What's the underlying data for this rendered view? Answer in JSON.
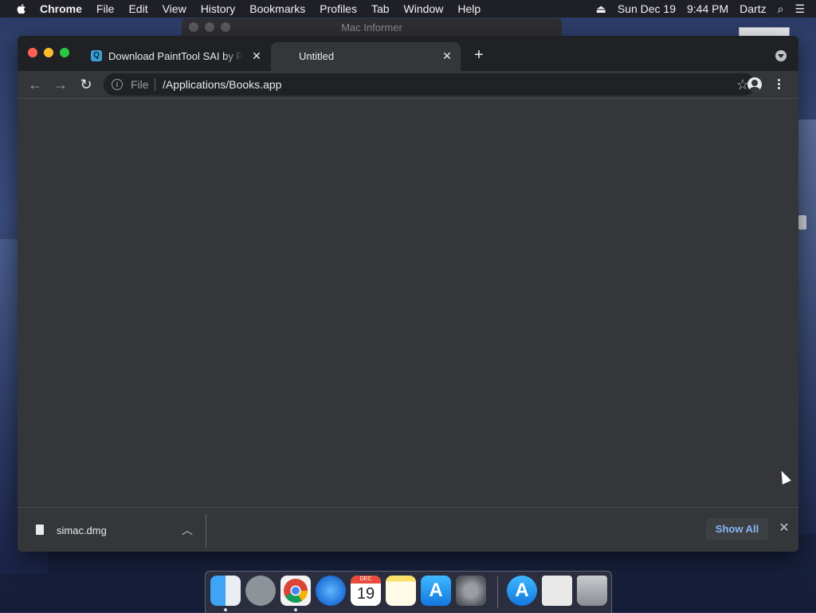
{
  "menubar": {
    "app_name": "Chrome",
    "items": [
      "File",
      "Edit",
      "View",
      "History",
      "Bookmarks",
      "Profiles",
      "Tab",
      "Window",
      "Help"
    ],
    "date": "Sun Dec 19",
    "time": "9:44 PM",
    "user": "Dartz"
  },
  "background_window": {
    "title": "Mac Informer"
  },
  "browser": {
    "tabs": [
      {
        "title": "Download PaintTool SAI by Por",
        "favicon": "Q"
      },
      {
        "title": "Untitled"
      }
    ],
    "address": {
      "scheme_label": "File",
      "url": "/Applications/Books.app"
    }
  },
  "downloads_bar": {
    "file_name": "simac.dmg",
    "show_all_label": "Show All"
  },
  "dock": {
    "apps": [
      "finder-icon",
      "launchpad-icon",
      "chrome-icon",
      "safari-icon",
      "calendar-icon",
      "notes-icon",
      "app-store-icon",
      "system-preferences-icon",
      "app-store-downloads-icon",
      "disk-image-icon",
      "trash-icon"
    ],
    "calendar_month": "DEC",
    "calendar_day": "19"
  },
  "colors": {
    "tabstrip_bg": "#202124",
    "toolbar_bg": "#35363a",
    "accent_link": "#8ab4f8"
  }
}
